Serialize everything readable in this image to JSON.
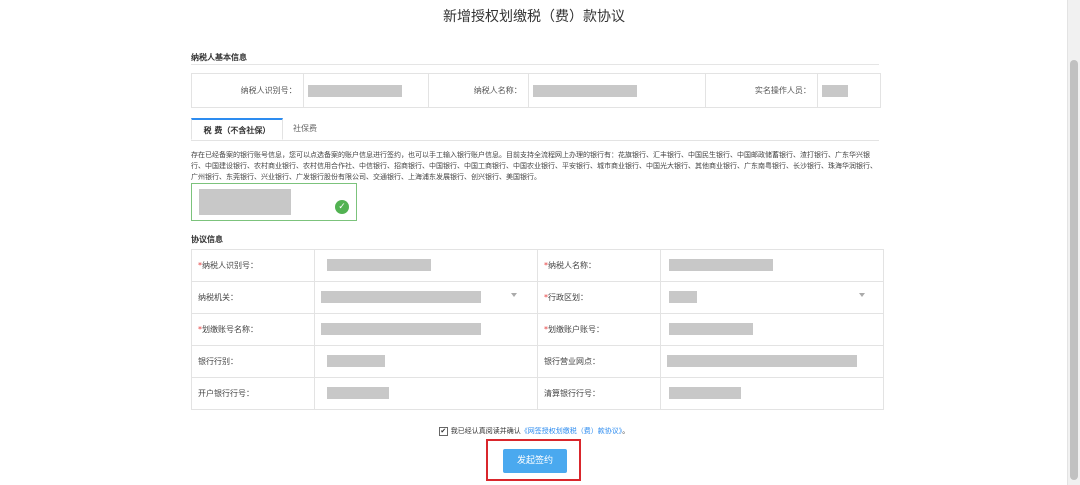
{
  "page_title": "新增授权划缴税（费）款协议",
  "basic_info": {
    "heading": "纳税人基本信息",
    "taxpayer_id_label": "纳税人识别号：",
    "taxpayer_name_label": "纳税人名称：",
    "operator_label": "实名操作人员："
  },
  "tabs": [
    {
      "label": "税 费（不含社保）",
      "active": true
    },
    {
      "label": "社保费",
      "active": false
    }
  ],
  "notice": "存在已经备案的银行账号信息，您可以点选备案的账户信息进行签约，也可以手工输入银行账户信息。目前支持全流程网上办理的银行有：花旗银行、汇丰银行、中国民生银行、中国邮政储蓄银行、渣打银行、广东华兴银行、中国建设银行、农村商业银行、农村信用合作社、中信银行、招商银行、中国银行、中国工商银行、中国农业银行、平安银行、城市商业银行、中国光大银行、其他商业银行、广东南粤银行、长沙银行、珠海华润银行、广州银行、东莞银行、兴业银行、广发银行股份有限公司、交通银行、上海浦东发展银行、创兴银行、美国银行。",
  "protocol": {
    "heading": "协议信息",
    "rows": [
      {
        "left_label": "纳税人识别号：",
        "left_required": true,
        "right_label": "纳税人名称：",
        "right_required": true
      },
      {
        "left_label": "纳税机关：",
        "left_required": false,
        "right_label": "行政区划：",
        "right_required": true
      },
      {
        "left_label": "划缴账号名称：",
        "left_required": true,
        "right_label": "划缴账户账号：",
        "right_required": true
      },
      {
        "left_label": "银行行别：",
        "left_required": false,
        "right_label": "银行营业网点：",
        "right_required": false
      },
      {
        "left_label": "开户银行行号：",
        "left_required": false,
        "right_label": "清算银行行号：",
        "right_required": false
      }
    ]
  },
  "agreement": {
    "checked_mark": "✔",
    "prefix": "我已经认真阅读并确认",
    "link": "《网签授权划缴税（费）款协议》",
    "suffix": "。"
  },
  "submit_label": "发起签约",
  "colors": {
    "accent": "#2d8cf0",
    "button": "#4aa9ef",
    "highlight_frame": "#d9262c",
    "success": "#52b252"
  }
}
